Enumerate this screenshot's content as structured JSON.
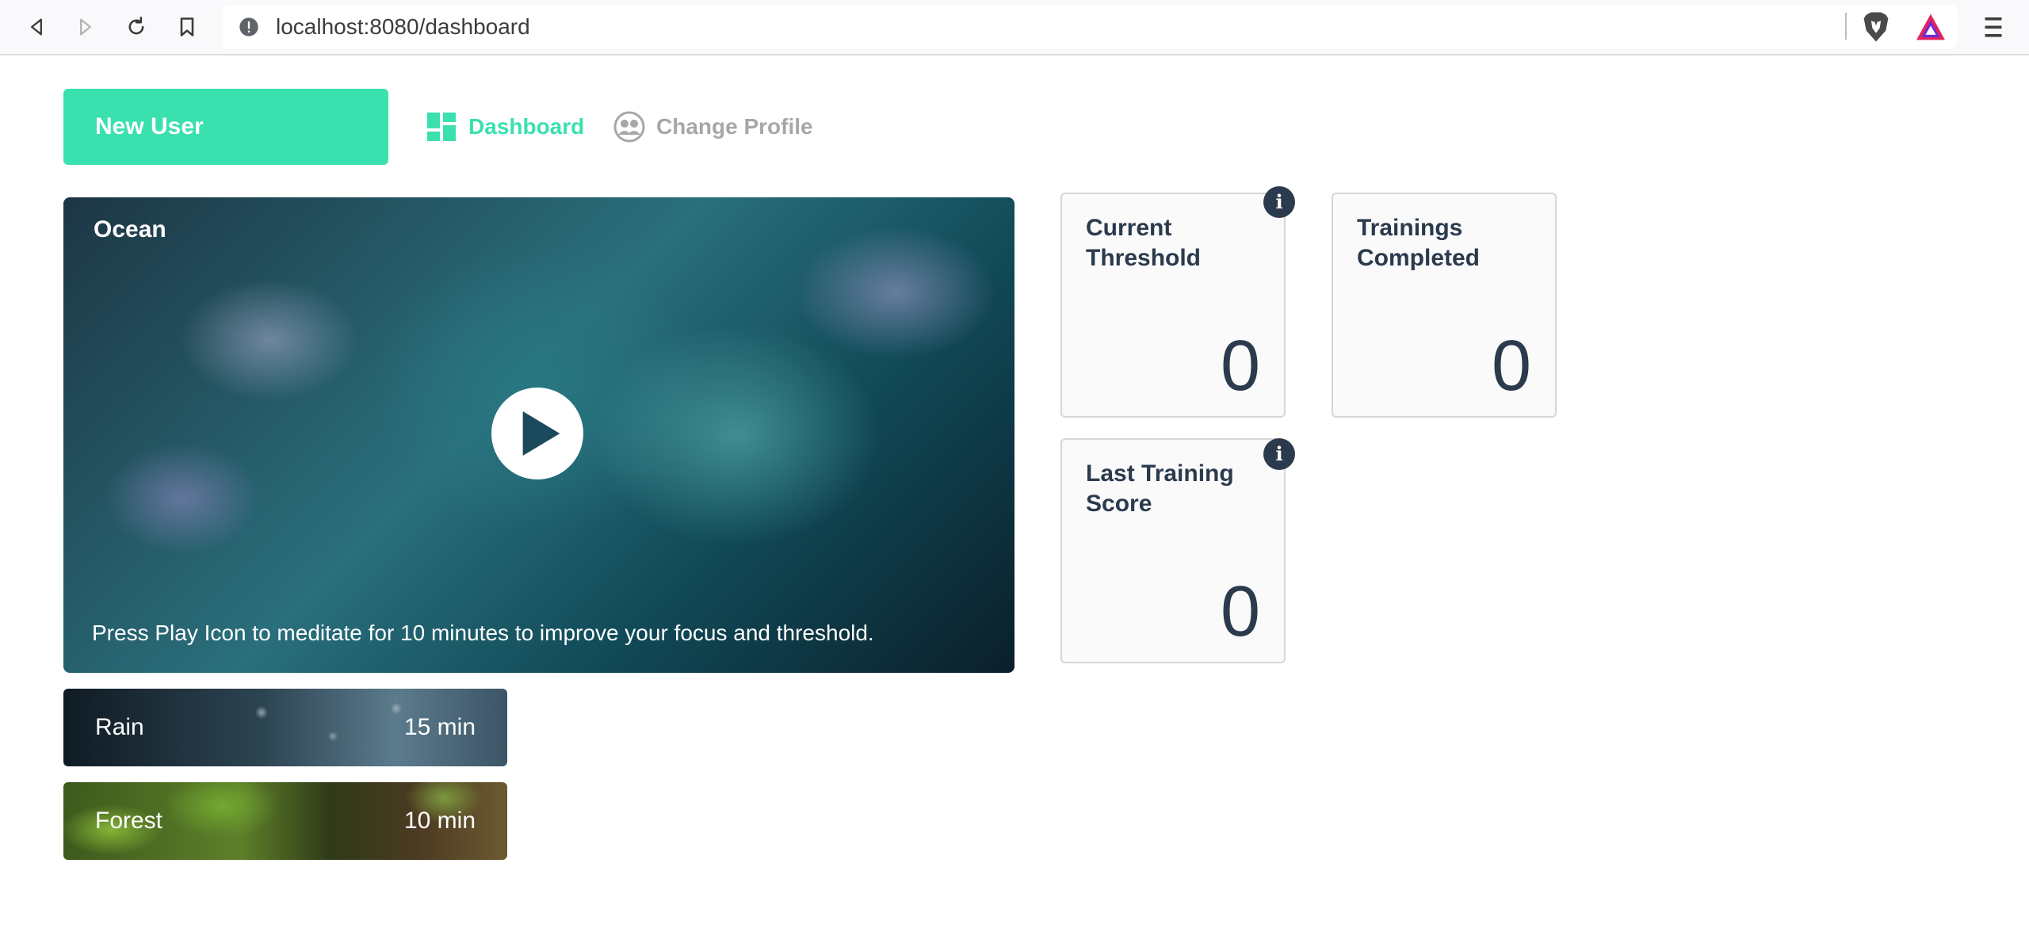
{
  "browser": {
    "url": "localhost:8080/dashboard"
  },
  "header": {
    "user_button": "New User",
    "nav": [
      {
        "label": "Dashboard",
        "active": true,
        "icon": "dashboard-icon"
      },
      {
        "label": "Change Profile",
        "active": false,
        "icon": "profile-icon"
      }
    ]
  },
  "player": {
    "title": "Ocean",
    "caption": "Press Play Icon to meditate for 10 minutes to improve your focus and threshold."
  },
  "tracks": [
    {
      "name": "Rain",
      "duration": "15 min"
    },
    {
      "name": "Forest",
      "duration": "10 min"
    }
  ],
  "stats": [
    {
      "label": "Current Threshold",
      "value": "0",
      "has_info": true
    },
    {
      "label": "Trainings Completed",
      "value": "0",
      "has_info": false
    },
    {
      "label": "Last Training Score",
      "value": "0",
      "has_info": true
    }
  ],
  "colors": {
    "accent": "#3ae0ae",
    "text_dark": "#2b3a4d",
    "muted": "#a7a7a7"
  }
}
